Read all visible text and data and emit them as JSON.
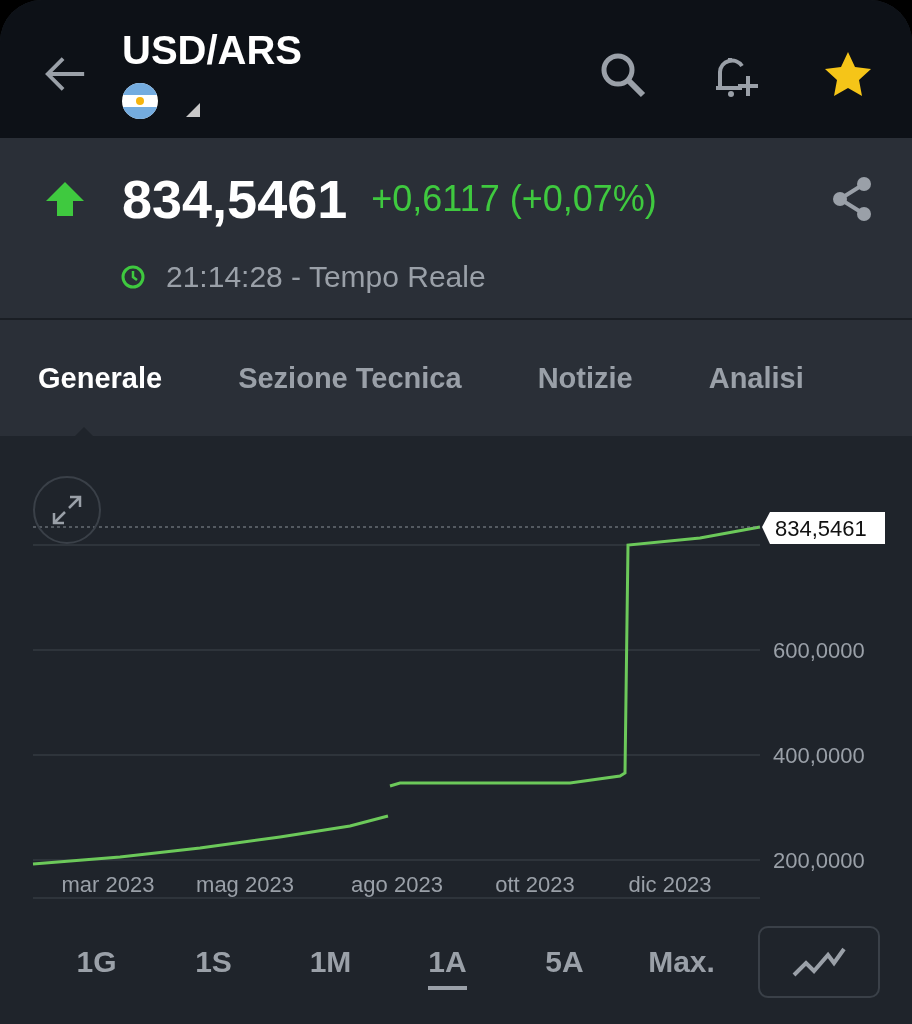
{
  "header": {
    "symbol": "USD/ARS"
  },
  "quote": {
    "price": "834,5461",
    "change": "+0,6117 (+0,07%)",
    "rising": true,
    "time": "21:14:28 - Tempo Reale"
  },
  "tabs": [
    {
      "label": "Generale",
      "selected": true
    },
    {
      "label": "Sezione Tecnica",
      "selected": false
    },
    {
      "label": "Notizie",
      "selected": false
    },
    {
      "label": "Analisi",
      "selected": false
    }
  ],
  "chart": {
    "current_price_tag": "834,5461",
    "y_axis_labels": [
      "600,0000",
      "400,0000",
      "200,0000"
    ],
    "x_axis_labels": [
      "mar 2023",
      "mag 2023",
      "ago 2023",
      "ott 2023",
      "dic 2023"
    ]
  },
  "ranges": [
    {
      "label": "1G",
      "selected": false
    },
    {
      "label": "1S",
      "selected": false
    },
    {
      "label": "1M",
      "selected": false
    },
    {
      "label": "1A",
      "selected": true
    },
    {
      "label": "5A",
      "selected": false
    },
    {
      "label": "Max.",
      "selected": false
    }
  ]
}
